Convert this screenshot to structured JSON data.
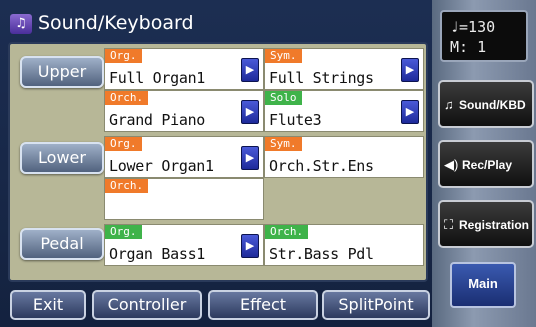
{
  "header": {
    "title": "Sound/Keyboard",
    "icon": "music-note-icon"
  },
  "parts": [
    {
      "label": "Upper"
    },
    {
      "label": "Lower"
    },
    {
      "label": "Pedal"
    }
  ],
  "cells": {
    "upper1": {
      "category": "Org.",
      "tone": "Full Organ1"
    },
    "upper2": {
      "category": "Sym.",
      "tone": "Full Strings"
    },
    "upper3": {
      "category": "Orch.",
      "tone": "Grand Piano"
    },
    "upper4": {
      "category": "Solo",
      "tone": "Flute3"
    },
    "lower1": {
      "category": "Org.",
      "tone": "Lower Organ1"
    },
    "lower2": {
      "category": "Sym.",
      "tone": "Orch.Str.Ens"
    },
    "lower3": {
      "category": "Orch.",
      "tone": ""
    },
    "pedal1": {
      "category": "Org.",
      "tone": "Organ Bass1"
    },
    "pedal2": {
      "category": "Orch.",
      "tone": "Str.Bass Pdl"
    }
  },
  "bottom": {
    "exit": "Exit",
    "controller": "Controller",
    "effect": "Effect",
    "splitpoint": "SplitPoint"
  },
  "tempo": {
    "line1": "♩=130",
    "line2": "M:    1"
  },
  "side": {
    "sound_kbd": "Sound/KBD",
    "rec_play": "Rec/Play",
    "registration": "Registration",
    "main": "Main"
  },
  "colors": {
    "category_orange": "#f07a2a",
    "category_green": "#3fb34a",
    "work_area": "#b7b797",
    "panel_bg": "#1c2e52"
  }
}
